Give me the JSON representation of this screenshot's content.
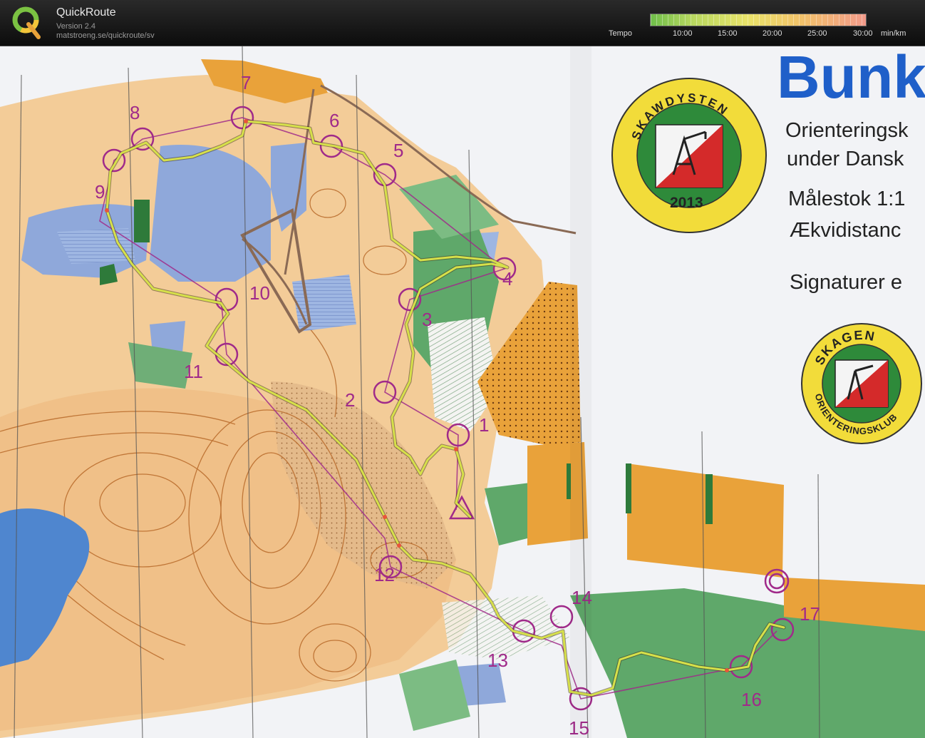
{
  "app": {
    "title": "QuickRoute",
    "version": "Version 2.4",
    "url": "matstroeng.se/quickroute/sv"
  },
  "tempo": {
    "label": "Tempo",
    "ticks": [
      "10:00",
      "15:00",
      "20:00",
      "25:00",
      "30:00"
    ],
    "unit": "min/km",
    "colors": [
      "#6fbf4a",
      "#e9e36a",
      "#f29a8a"
    ]
  },
  "map": {
    "event_title": "Bunk",
    "info_lines": [
      "Orienteringsk",
      "under Dansk",
      "Målestok 1:1",
      "Ækvidistanc",
      "Signaturer e"
    ],
    "badge1": {
      "top": "SKAWDYSTEN",
      "year": "2013"
    },
    "badge2": {
      "top": "SKAGEN",
      "bottom": "ORIENTERINGSKLUB"
    },
    "controls": [
      "1",
      "2",
      "3",
      "4",
      "5",
      "6",
      "7",
      "8",
      "9",
      "10",
      "11",
      "12",
      "13",
      "14",
      "15",
      "16",
      "17"
    ],
    "colors": {
      "open_land": "#f3cc98",
      "water": "#8aa4d8",
      "forest": "#5fa86a",
      "yellow": "#e9a23a",
      "course": "#a02a8a",
      "route": "#d6e04a"
    }
  }
}
